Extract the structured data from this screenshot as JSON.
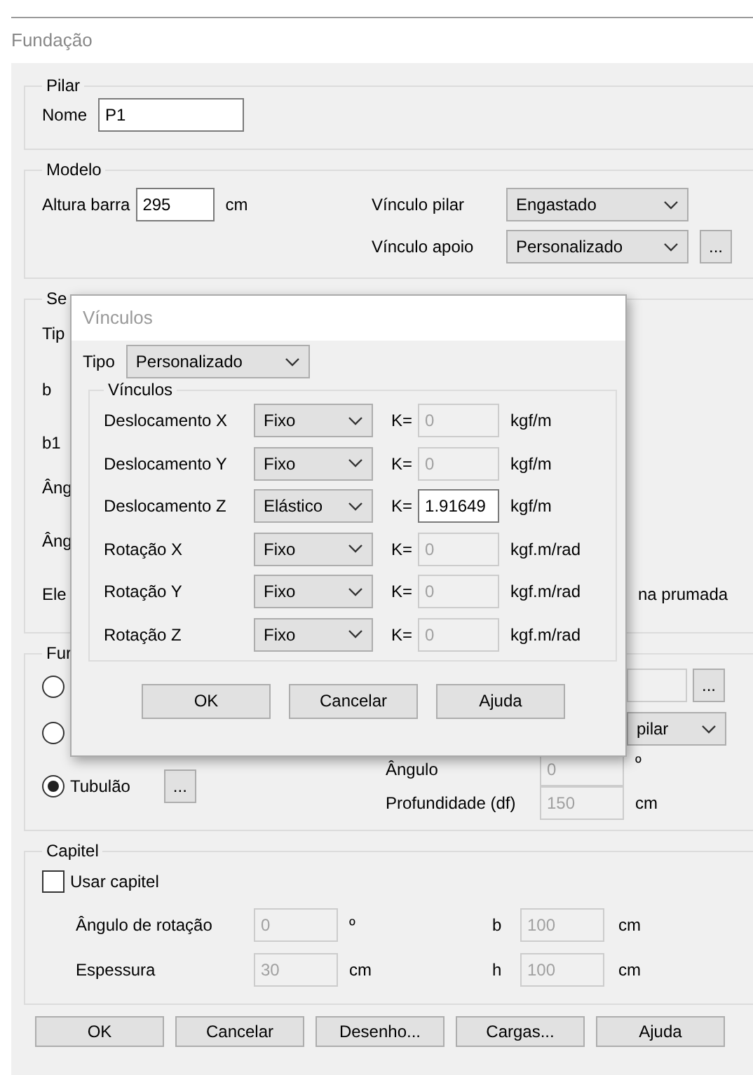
{
  "window": {
    "title": "Fundação"
  },
  "pilar": {
    "legend": "Pilar",
    "name_label": "Nome",
    "name_value": "P1"
  },
  "modelo": {
    "legend": "Modelo",
    "altura_label": "Altura barra",
    "altura_value": "295",
    "altura_unit": "cm",
    "vinculo_pilar": {
      "label": "Vínculo pilar",
      "value": "Engastado"
    },
    "vinculo_apoio": {
      "label": "Vínculo apoio",
      "value": "Personalizado",
      "button": "..."
    }
  },
  "secao": {
    "legend": "Se",
    "labels": [
      "Tip",
      "b",
      "b1",
      "Âng",
      "Âng",
      "Ele"
    ],
    "right_text": "na prumada"
  },
  "fundacao": {
    "legend": "Fur",
    "options": [
      {
        "selected": false
      },
      {
        "selected": false
      },
      {
        "label": "Tubulão",
        "selected": true,
        "button": "..."
      }
    ],
    "field_button": "...",
    "dropdown_value": "pilar",
    "angulo": {
      "label": "Ângulo",
      "value": "0",
      "unit": "º",
      "disabled": true
    },
    "profundidade": {
      "label": "Profundidade (df)",
      "value": "150",
      "unit": "cm",
      "disabled": true
    }
  },
  "capitel": {
    "legend": "Capitel",
    "checkbox": {
      "label": "Usar capitel",
      "checked": false
    },
    "fields": [
      {
        "label": "Ângulo de rotação",
        "value": "0",
        "unit": "º",
        "disabled": true
      },
      {
        "label": "b",
        "value": "100",
        "unit": "cm",
        "disabled": true
      },
      {
        "label": "Espessura",
        "value": "30",
        "unit": "cm",
        "disabled": true
      },
      {
        "label": "h",
        "value": "100",
        "unit": "cm",
        "disabled": true
      }
    ]
  },
  "buttons": [
    "OK",
    "Cancelar",
    "Desenho...",
    "Cargas...",
    "Ajuda"
  ],
  "dialog": {
    "title": "Vínculos",
    "tipo_label": "Tipo",
    "tipo_value": "Personalizado",
    "legend": "Vínculos",
    "rows": [
      {
        "label": "Deslocamento X",
        "type": "Fixo",
        "k_label": "K=",
        "k_value": "0",
        "unit": "kgf/m",
        "disabled": true
      },
      {
        "label": "Deslocamento Y",
        "type": "Fixo",
        "k_label": "K=",
        "k_value": "0",
        "unit": "kgf/m",
        "disabled": true
      },
      {
        "label": "Deslocamento Z",
        "type": "Elástico",
        "k_label": "K=",
        "k_value": "1.91649",
        "unit": "kgf/m",
        "disabled": false
      },
      {
        "label": "Rotação X",
        "type": "Fixo",
        "k_label": "K=",
        "k_value": "0",
        "unit": "kgf.m/rad",
        "disabled": true
      },
      {
        "label": "Rotação Y",
        "type": "Fixo",
        "k_label": "K=",
        "k_value": "0",
        "unit": "kgf.m/rad",
        "disabled": true
      },
      {
        "label": "Rotação Z",
        "type": "Fixo",
        "k_label": "K=",
        "k_value": "0",
        "unit": "kgf.m/rad",
        "disabled": true
      }
    ],
    "buttons": [
      "OK",
      "Cancelar",
      "Ajuda"
    ]
  }
}
